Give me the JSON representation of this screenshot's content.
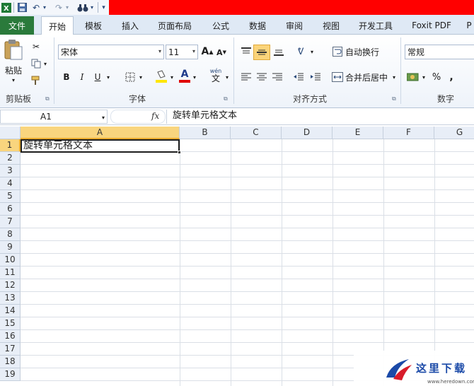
{
  "qat": {
    "excel_icon": "excel-icon",
    "save_icon": "save-icon",
    "undo_icon": "undo-icon",
    "redo_icon": "redo-icon",
    "binoculars_icon": "binoculars-icon",
    "customize_icon": "customize-qat-icon"
  },
  "tabs": [
    {
      "label": "文件"
    },
    {
      "label": "开始"
    },
    {
      "label": "模板"
    },
    {
      "label": "插入"
    },
    {
      "label": "页面布局"
    },
    {
      "label": "公式"
    },
    {
      "label": "数据"
    },
    {
      "label": "审阅"
    },
    {
      "label": "视图"
    },
    {
      "label": "开发工具"
    },
    {
      "label": "Foxit PDF"
    },
    {
      "label": "P"
    }
  ],
  "ribbon": {
    "clipboard": {
      "paste_label": "粘贴",
      "group_label": "剪贴板"
    },
    "font": {
      "font_name": "宋体",
      "font_size": "11",
      "bold": "B",
      "italic": "I",
      "underline": "U",
      "group_label": "字体",
      "color_a": "A",
      "wen": "wén"
    },
    "alignment": {
      "wrap_text": "自动换行",
      "merge_center": "合并后居中",
      "group_label": "对齐方式"
    },
    "number": {
      "format": "常规",
      "percent": "%",
      "comma": ",",
      "group_label": "数字"
    }
  },
  "formula_bar": {
    "name_box": "A1",
    "fx_label": "fx",
    "formula": "旋转单元格文本"
  },
  "sheet": {
    "columns": [
      "A",
      "B",
      "C",
      "D",
      "E",
      "F",
      "G"
    ],
    "rows": [
      "1",
      "2",
      "3",
      "4",
      "5",
      "6",
      "7",
      "8",
      "9",
      "10",
      "11",
      "12",
      "13",
      "14",
      "15",
      "16",
      "17",
      "18",
      "19"
    ],
    "cell_A1": "旋转单元格文本"
  },
  "watermark": {
    "text": "这里下载",
    "url": "www.heredown.com"
  },
  "colors": {
    "title_bar": "#ff0000",
    "file_tab": "#2a7a3b",
    "selected_header": "#f9d57e"
  }
}
